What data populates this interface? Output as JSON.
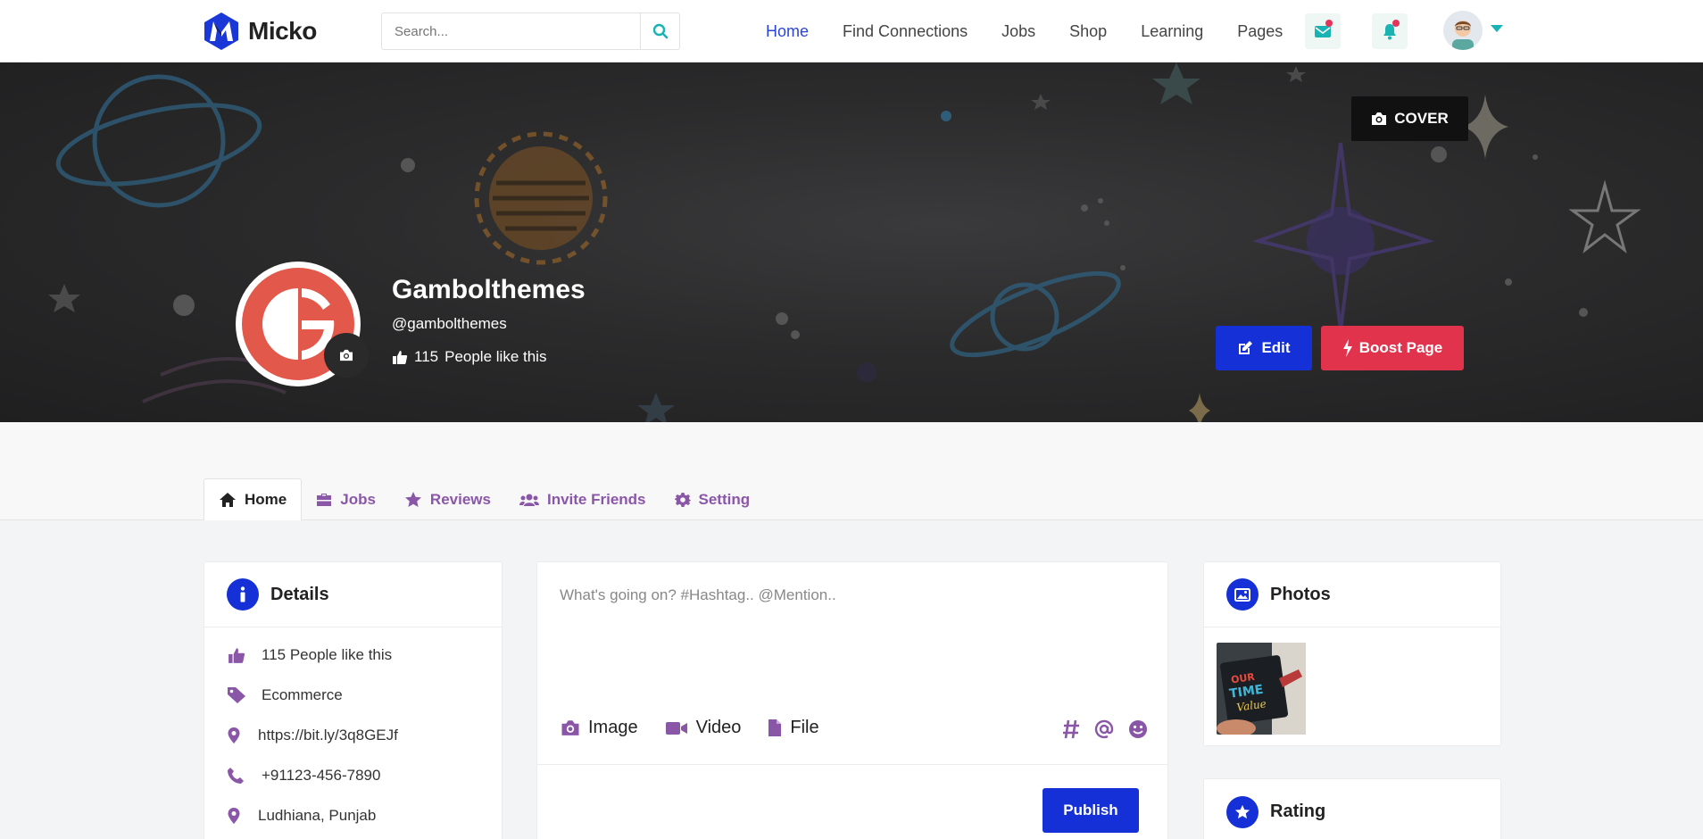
{
  "app": {
    "name": "Micko"
  },
  "search": {
    "placeholder": "Search..."
  },
  "nav": {
    "items": [
      {
        "label": "Home",
        "active": true
      },
      {
        "label": "Find Connections"
      },
      {
        "label": "Jobs"
      },
      {
        "label": "Shop"
      },
      {
        "label": "Learning"
      },
      {
        "label": "Pages"
      }
    ]
  },
  "cover": {
    "cover_button_label": "COVER",
    "page_name": "Gambolthemes",
    "handle": "@gambolthemes",
    "likes_count": "115",
    "likes_label": "People like this",
    "edit_label": "Edit",
    "boost_label": "Boost Page"
  },
  "tabs": [
    {
      "label": "Home",
      "icon": "home-icon",
      "active": true
    },
    {
      "label": "Jobs",
      "icon": "briefcase-icon"
    },
    {
      "label": "Reviews",
      "icon": "star-icon"
    },
    {
      "label": "Invite Friends",
      "icon": "users-icon"
    },
    {
      "label": "Setting",
      "icon": "gear-icon"
    }
  ],
  "details": {
    "title": "Details",
    "rows": [
      {
        "icon": "thumbs-up-icon",
        "text": "115 People like this"
      },
      {
        "icon": "tag-icon",
        "text": "Ecommerce"
      },
      {
        "icon": "map-pin-icon",
        "text": "https://bit.ly/3q8GEJf"
      },
      {
        "icon": "phone-icon",
        "text": "+91123-456-7890"
      },
      {
        "icon": "map-pin-icon",
        "text": "Ludhiana, Punjab"
      }
    ]
  },
  "composer": {
    "placeholder": "What's going on? #Hashtag.. @Mention..",
    "image_label": "Image",
    "video_label": "Video",
    "file_label": "File",
    "publish_label": "Publish"
  },
  "photos": {
    "title": "Photos"
  },
  "rating": {
    "title": "Rating"
  },
  "colors": {
    "accent_blue": "#1530d6",
    "boost_red": "#e2334d",
    "tab_purple": "#8a57a8",
    "teal": "#19b3b3"
  }
}
